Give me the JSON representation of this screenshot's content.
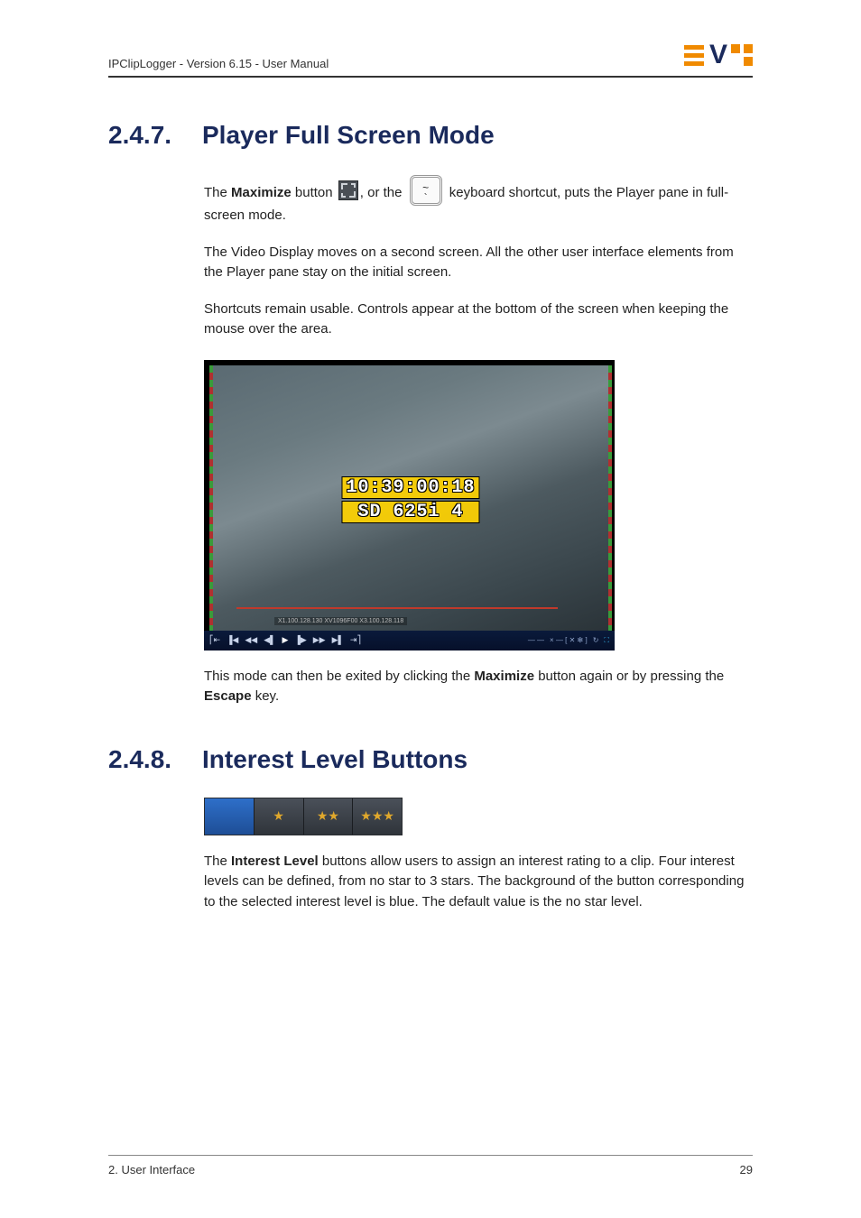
{
  "header": {
    "text": "IPClipLogger - Version 6.15 - User Manual",
    "logo_letter": "V"
  },
  "sections": [
    {
      "number": "2.4.7.",
      "title": "Player Full Screen Mode",
      "p1": {
        "a": "The ",
        "bold1": "Maximize",
        "b": " button ",
        "c": ", or the ",
        "d": " keyboard shortcut, puts the Player pane in full-screen mode."
      },
      "p2": "The Video Display moves on a second screen. All the other user interface elements from the Player pane stay on the initial screen.",
      "p3": "Shortcuts remain usable. Controls appear at the bottom of the screen when keeping the mouse over the area.",
      "p4": {
        "a": "This mode can then be exited by clicking the ",
        "bold1": "Maximize",
        "b": " button again or by pressing the ",
        "bold2": "Escape",
        "c": " key."
      }
    },
    {
      "number": "2.4.8.",
      "title": "Interest Level Buttons",
      "p1": {
        "a": "The ",
        "bold1": "Interest Level",
        "b": " buttons allow users to assign an interest rating to a clip. Four interest levels can be defined, from no star to 3 stars. The background of the button corresponding to the selected interest level is blue. The default value is the no star level."
      }
    }
  ],
  "player": {
    "overlay": {
      "line1": "10:39:00:18",
      "line2": "SD 625i  4"
    },
    "scene_label": "X1.100.128.130  XV1096F00  X3.100.128.118",
    "controls": {
      "goto_in": "⎡⇤",
      "skip_back": "▐◀",
      "rewind": "◀◀",
      "step_back": "◀▌",
      "play": "▶",
      "step_fwd": "▐▶",
      "forward": "▶▶",
      "skip_fwd": "▶▌",
      "goto_out": "⇥⎤",
      "right1": "— —",
      "right2": "× — [ ✕  ✻ ]",
      "right3": "↻",
      "right4": "⛶"
    }
  },
  "interest": {
    "buttons": [
      "",
      "★",
      "★★",
      "★★★"
    ]
  },
  "footer": {
    "left": "2. User Interface",
    "page": "29"
  }
}
